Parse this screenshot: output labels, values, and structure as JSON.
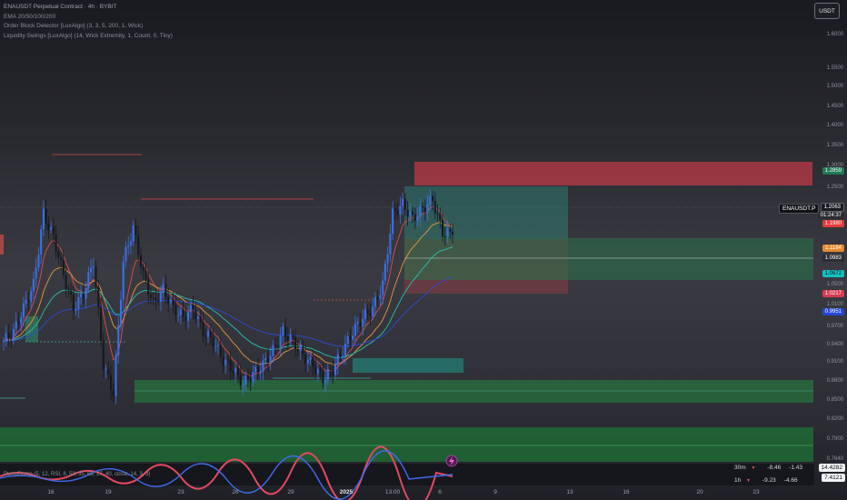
{
  "legend": {
    "symbol_line": "ENAUSDT Perpetual Contract · 4h · BYBIT",
    "ema_line": "EMA 20/50/100/200",
    "order_block_line": "Order Block Detector [LuxAlgo] (3, 3, 5, 200, 1, Wick)",
    "liquidity_line": "Liquidity Swings [LuxAlgo] (14, Wick Extremity, 1, Count, 0, Tiny)"
  },
  "currency_button": "USDT",
  "symbol_tag": "ENAUSDT.P",
  "price_scale": {
    "ticks": [
      "1.6000",
      "1.5500",
      "1.5000",
      "1.4500",
      "1.4000",
      "1.3500",
      "1.3000",
      "1.2500",
      "1.0500",
      "1.0100",
      "0.9700",
      "0.9400",
      "0.9100",
      "0.8800",
      "0.8500",
      "0.8200",
      "0.7900",
      "0.7640"
    ],
    "badges": [
      {
        "text": "1.2859",
        "color": "green"
      },
      {
        "text": "1.2063",
        "color": "white"
      },
      {
        "text": "01:24:37",
        "color": "grey"
      },
      {
        "text": "1.1980",
        "color": "red"
      },
      {
        "text": "1.1184",
        "color": "orange"
      },
      {
        "text": "1.0983",
        "color": "grey"
      },
      {
        "text": "1.0672",
        "color": "teal"
      },
      {
        "text": "1.0217",
        "color": "red2"
      },
      {
        "text": "0.9951",
        "color": "blue"
      }
    ]
  },
  "time_axis": [
    "16",
    "19",
    "23",
    "26",
    "29",
    "2025",
    "13:00",
    "6",
    "9",
    "13",
    "16",
    "20",
    "23"
  ],
  "oscillator": {
    "legend": "PumpDump (5, 12, RSI, 8, 53, 35, 65, 17, 40, close, 14, 3, 3)",
    "rows": [
      {
        "tf": "30m",
        "a": "-8.46",
        "b": "-1.43"
      },
      {
        "tf": "1h",
        "a": "-9.23",
        "b": "-4.66"
      }
    ],
    "badges": [
      "14.4282",
      "7.4121"
    ]
  },
  "chart_data": {
    "type": "candlestick",
    "x_labels": [
      "16",
      "19",
      "23",
      "26",
      "29",
      "2025",
      "13:00",
      "6"
    ],
    "close_series": [
      0.98,
      1.0,
      1.05,
      1.1,
      1.25,
      1.2,
      1.12,
      1.05,
      1.08,
      1.15,
      0.93,
      0.87,
      1.15,
      1.22,
      1.12,
      1.06,
      1.09,
      1.05,
      1.03,
      1.05,
      1.0,
      0.98,
      0.94,
      0.92,
      0.89,
      0.91,
      0.93,
      0.96,
      1.0,
      0.98,
      0.95,
      0.93,
      0.9,
      0.92,
      0.96,
      1.0,
      1.03,
      1.05,
      1.1,
      1.25,
      1.27,
      1.24,
      1.26,
      1.28,
      1.21,
      1.2063
    ],
    "price_ticks": [
      1.6,
      1.55,
      1.5,
      1.45,
      1.4,
      1.35,
      1.3,
      1.25,
      1.05,
      1.01,
      0.97,
      0.94,
      0.91,
      0.88,
      0.85,
      0.82,
      0.79,
      0.764
    ],
    "y_range": [
      0.73,
      1.63
    ],
    "last_price": 1.2063,
    "countdown": "01:24:37"
  }
}
